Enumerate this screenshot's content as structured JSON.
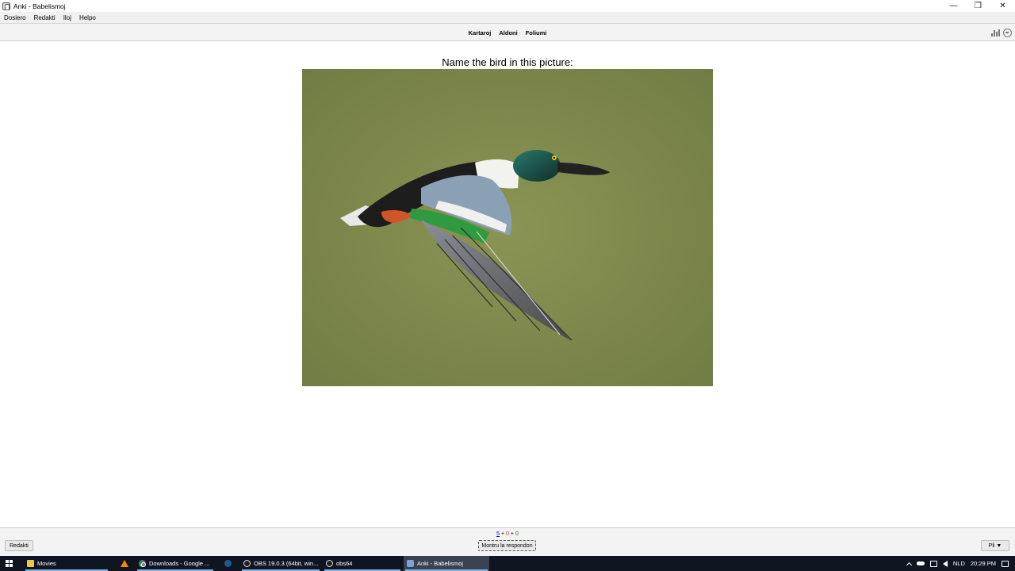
{
  "window": {
    "title": "Anki - Babelismoj",
    "controls": {
      "minimize": "—",
      "restore": "❐",
      "close": "✕"
    }
  },
  "menubar": {
    "items": [
      "Dosiero",
      "Redakti",
      "Iloj",
      "Helpo"
    ]
  },
  "toolbar": {
    "links": [
      "Kartaroj",
      "Aldoni",
      "Foliumi"
    ],
    "right_icons": [
      "stats-icon",
      "sync-icon"
    ]
  },
  "card": {
    "question": "Name the bird in this picture:",
    "image": {
      "subject": "duck-in-flight",
      "colors": {
        "background": "#7f8a4c",
        "head": "#1f5a4a",
        "speculum": "#2f9a3e"
      }
    }
  },
  "bottombar": {
    "edit_label": "Redakti",
    "counts": {
      "new": "5",
      "learning": "0",
      "review": "0",
      "plus": "+"
    },
    "show_answer_label": "Montru la respondon",
    "more_label": "Pli ▼"
  },
  "taskbar": {
    "items": [
      {
        "label": "Movies",
        "icon": "folder-icon",
        "active": false
      },
      {
        "label": "",
        "icon": "vlc-icon",
        "active": false
      },
      {
        "label": "Downloads - Google ...",
        "icon": "chrome-icon",
        "active": false
      },
      {
        "label": "",
        "icon": "steam-icon",
        "active": false
      },
      {
        "label": "OBS 19.0.3 (64bit, win...",
        "icon": "obs-icon",
        "active": false
      },
      {
        "label": "obs64",
        "icon": "obs-icon",
        "active": false
      },
      {
        "label": "Anki - Babelismoj",
        "icon": "anki-icon",
        "active": true
      }
    ],
    "tray": {
      "language": "NLD",
      "time": "20:29 PM"
    }
  }
}
